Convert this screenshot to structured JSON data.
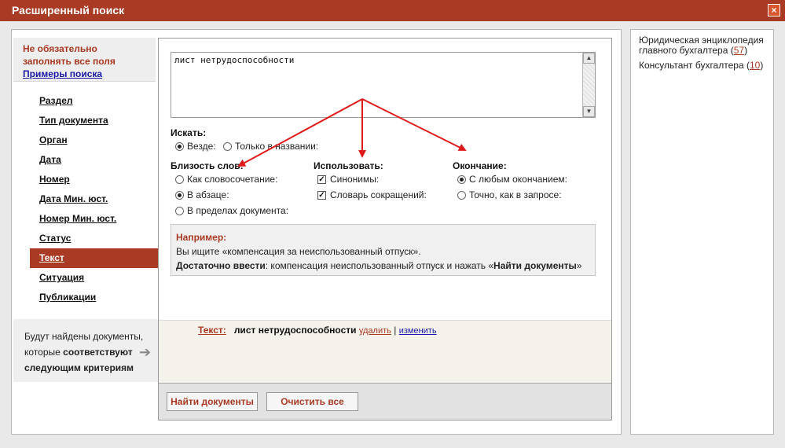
{
  "window": {
    "title": "Расширенный поиск",
    "close_icon": "×"
  },
  "hint": {
    "line1": "Не обязательно",
    "line2": "заполнять все поля",
    "examples_link": "Примеры поиска"
  },
  "nav": {
    "items": [
      {
        "label": "Раздел"
      },
      {
        "label": "Тип документа"
      },
      {
        "label": "Орган"
      },
      {
        "label": "Дата"
      },
      {
        "label": "Номер"
      },
      {
        "label": "Дата Мин. юст."
      },
      {
        "label": "Номер Мин. юст."
      },
      {
        "label": "Статус"
      },
      {
        "label": "Текст",
        "active": true
      },
      {
        "label": "Ситуация"
      },
      {
        "label": "Публикации"
      }
    ]
  },
  "found": {
    "line1": "Будут найдены документы,",
    "line2a": "которые",
    "line2b": "соответствуют",
    "line3": "следующим критериям"
  },
  "search": {
    "query": "лист нетрудоспособности",
    "search_in_label": "Искать:",
    "search_in_options": [
      "Везде:",
      "Только в названии:"
    ],
    "proximity_label": "Близость слов:",
    "proximity_options": [
      "Как словосочетание:",
      "В абзаце:",
      "В пределах документа:"
    ],
    "use_label": "Использовать:",
    "use_options": [
      "Синонимы:",
      "Словарь сокращений:"
    ],
    "ending_label": "Окончание:",
    "ending_options": [
      "С любым окончанием:",
      "Точно, как в запросе:"
    ]
  },
  "example": {
    "title": "Например:",
    "line1": "Вы ищите «компенсация за неиспользованный отпуск».",
    "line2_bold": "Достаточно ввести",
    "line2_mid": ": компенсация неиспользованный отпуск и нажать «",
    "line2_btn": "Найти документы",
    "line2_end": "»"
  },
  "criteria": {
    "label": "Текст:",
    "value": "лист нетрудоспособности",
    "delete": "удалить",
    "separator": "|",
    "change": "изменить"
  },
  "buttons": {
    "find": "Найти документы",
    "clear": "Очистить все"
  },
  "side": {
    "links": [
      {
        "text": "Юридическая энциклопедия главного бухгалтера",
        "count": "57"
      },
      {
        "text": "Консультант бухгалтера",
        "count": "10"
      }
    ]
  },
  "colors": {
    "accent": "#a93a23",
    "arrow": "#e01a1a"
  }
}
